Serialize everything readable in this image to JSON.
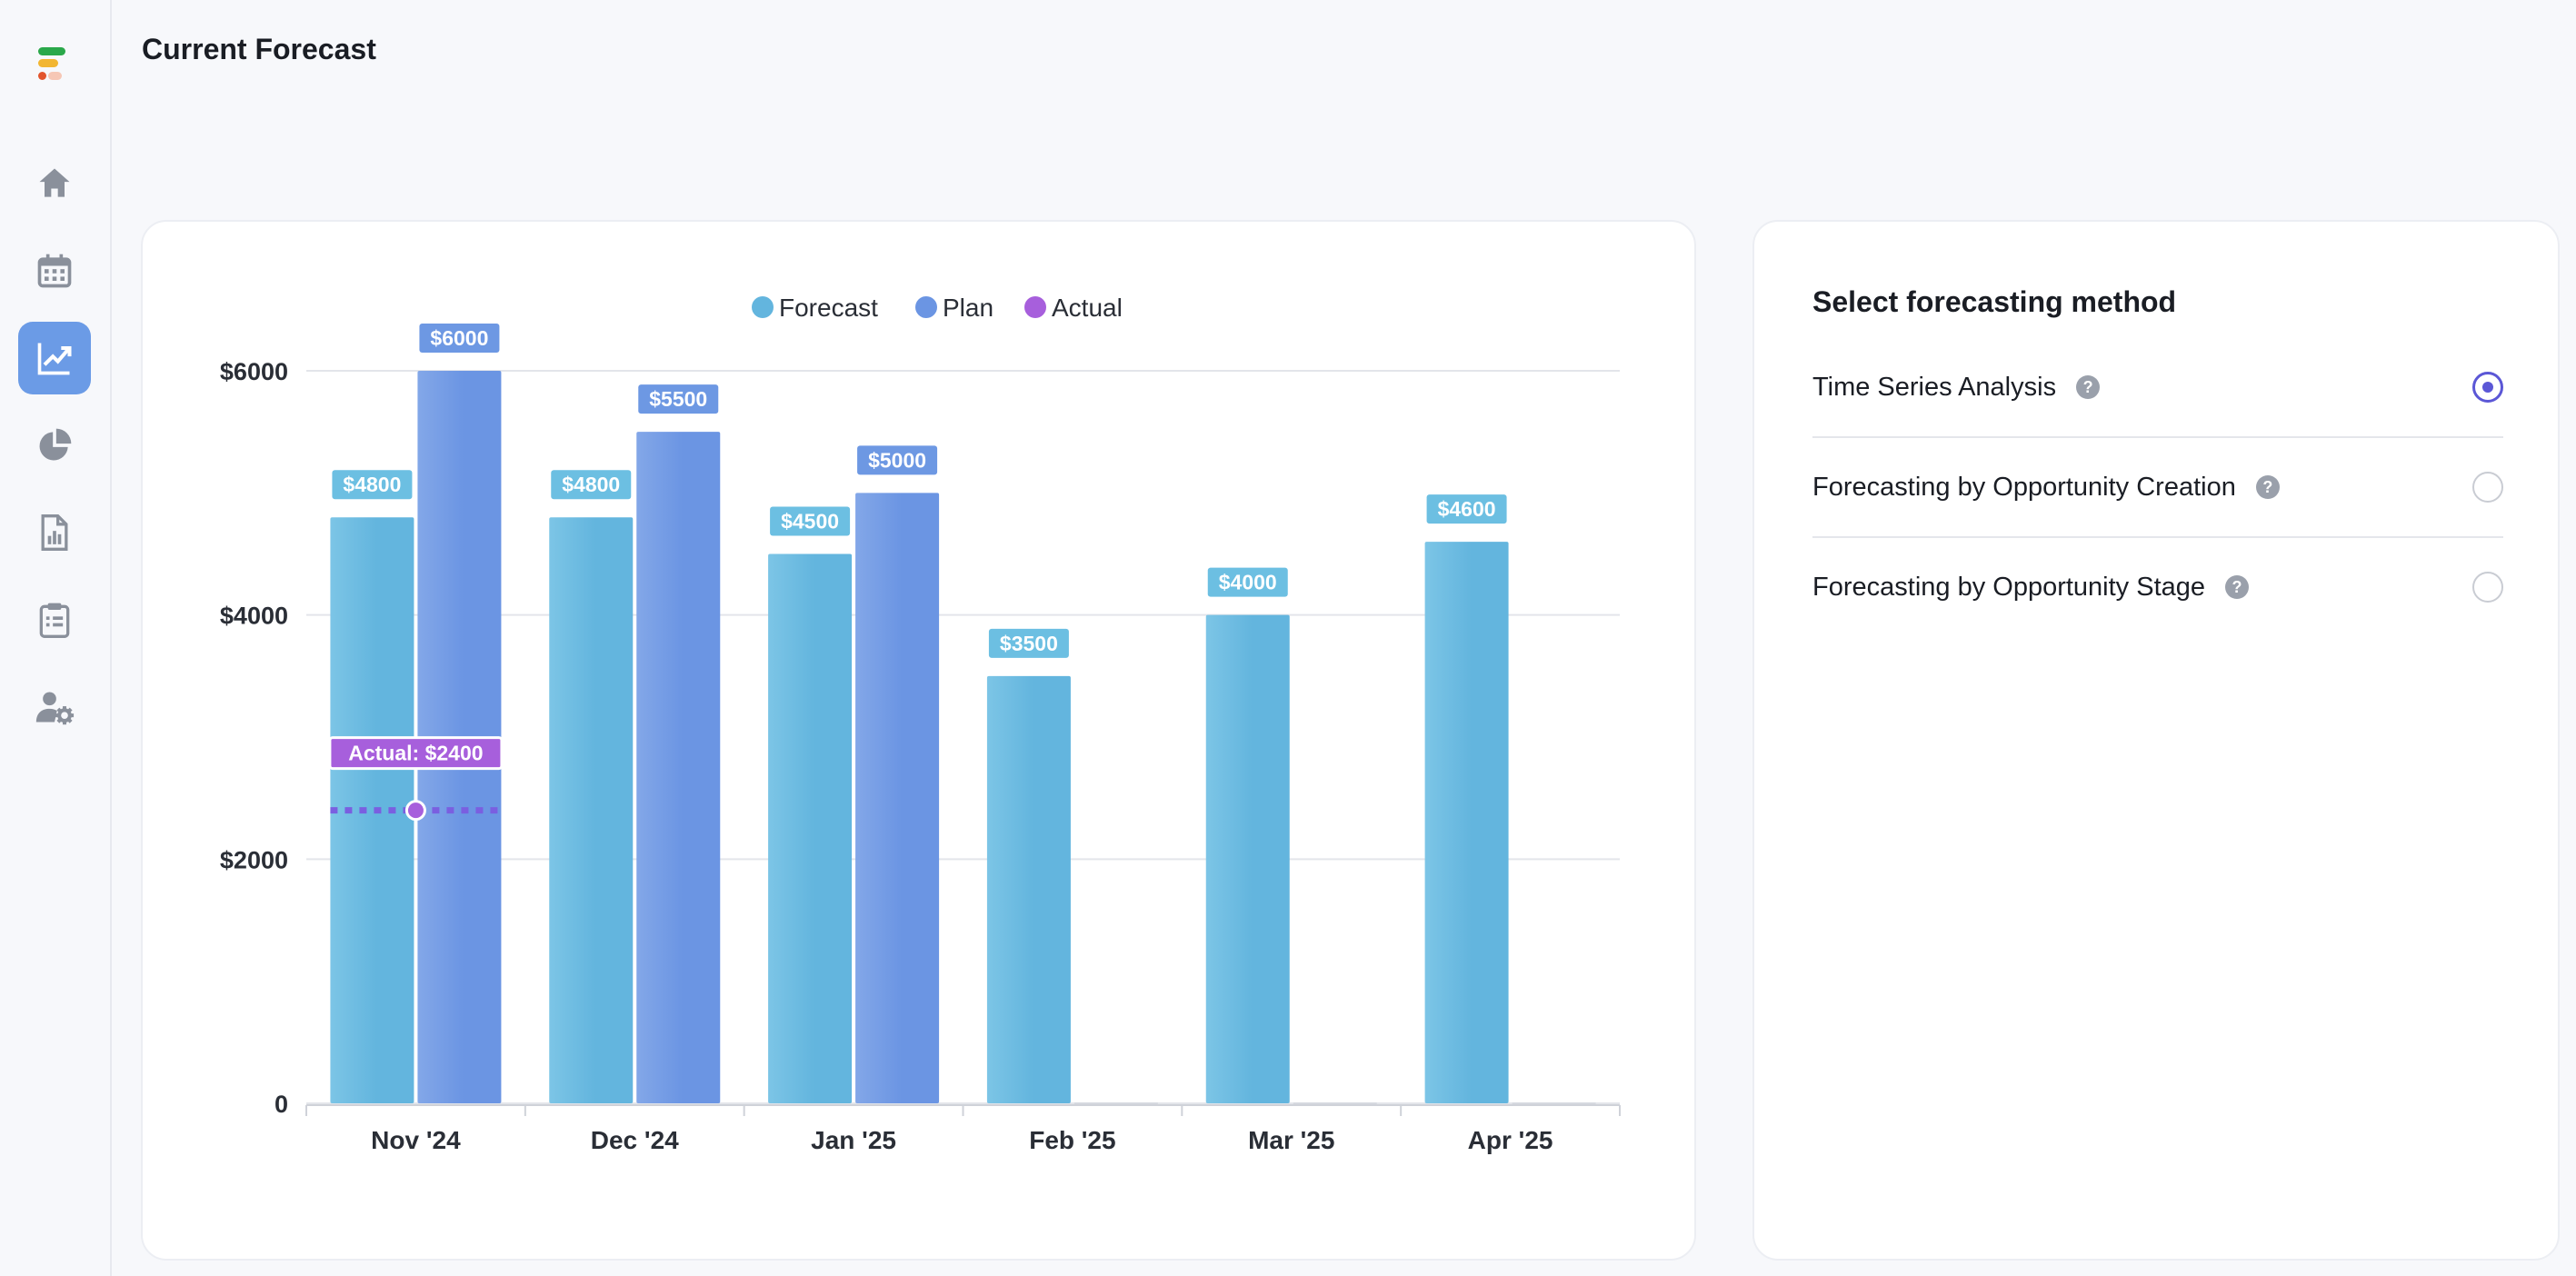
{
  "page": {
    "title": "Current Forecast"
  },
  "sidebar": {
    "items": [
      {
        "icon": "home-icon",
        "active": false
      },
      {
        "icon": "calendar-icon",
        "active": false
      },
      {
        "icon": "trend-chart-icon",
        "active": true
      },
      {
        "icon": "pie-chart-icon",
        "active": false
      },
      {
        "icon": "report-icon",
        "active": false
      },
      {
        "icon": "clipboard-icon",
        "active": false
      },
      {
        "icon": "user-settings-icon",
        "active": false
      }
    ]
  },
  "colors": {
    "forecast": "#63b5de",
    "plan": "#6b95e3",
    "actual": "#a75fdc",
    "radio_selected": "#5b57d6"
  },
  "chart_data": {
    "type": "bar",
    "categories": [
      "Nov '24",
      "Dec '24",
      "Jan '25",
      "Feb '25",
      "Mar '25",
      "Apr '25"
    ],
    "series": [
      {
        "name": "Forecast",
        "values": [
          4800,
          4800,
          4500,
          3500,
          4000,
          4600
        ]
      },
      {
        "name": "Plan",
        "values": [
          6000,
          5500,
          5000,
          null,
          null,
          null
        ]
      },
      {
        "name": "Actual",
        "values": [
          2400,
          null,
          null,
          null,
          null,
          null
        ]
      }
    ],
    "data_labels": {
      "Forecast": [
        "$4800",
        "$4800",
        "$4500",
        "$3500",
        "$4000",
        "$4600"
      ],
      "Plan": [
        "$6000",
        "$5500",
        "$5000",
        "",
        "",
        ""
      ],
      "Actual": [
        "Actual: $2400",
        "",
        "",
        "",
        "",
        ""
      ]
    },
    "y_ticks": [
      0,
      2000,
      4000,
      6000
    ],
    "y_tick_labels": [
      "0",
      "$2000",
      "$4000",
      "$6000"
    ],
    "ylim": [
      0,
      6000
    ],
    "legend_position": "top",
    "grid": true
  },
  "method_panel": {
    "title": "Select forecasting method",
    "options": [
      {
        "label": "Time Series Analysis",
        "help": "?",
        "selected": true
      },
      {
        "label": "Forecasting by Opportunity Creation",
        "help": "?",
        "selected": false
      },
      {
        "label": "Forecasting by Opportunity Stage",
        "help": "?",
        "selected": false
      }
    ]
  }
}
